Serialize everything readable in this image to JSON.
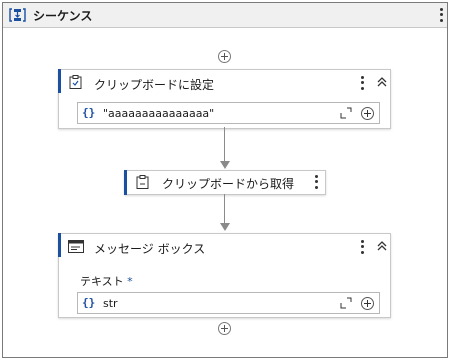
{
  "sequence": {
    "title": "シーケンス"
  },
  "activities": {
    "set_clipboard": {
      "title": "クリップボードに設定",
      "braces": "{}",
      "value": "\"aaaaaaaaaaaaaaa\""
    },
    "get_clipboard": {
      "title": "クリップボードから取得"
    },
    "message_box": {
      "title": "メッセージ ボックス",
      "field_label": "テキスト",
      "required_mark": "*",
      "braces": "{}",
      "value": "str"
    }
  },
  "colors": {
    "accent": "#1b4fa0",
    "connector": "#8a8a8a",
    "header_bg": "#f0f0f0"
  }
}
